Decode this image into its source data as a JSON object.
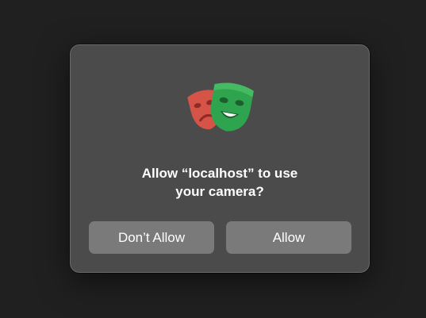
{
  "dialog": {
    "icon": "playwright-masks-icon",
    "message_line1": "Allow “localhost” to use",
    "message_line2": "your camera?",
    "deny_label": "Don’t Allow",
    "allow_label": "Allow"
  },
  "colors": {
    "background": "#202020",
    "dialog": "#4b4b4b",
    "button": "#7a7a7a",
    "mask_red": "#d65348",
    "mask_green": "#2ea44f"
  }
}
